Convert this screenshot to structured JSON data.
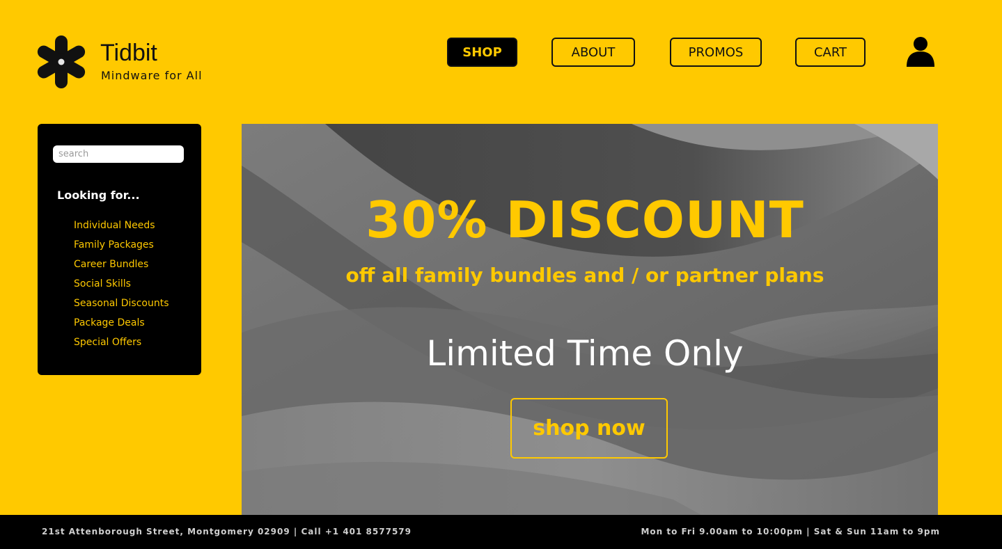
{
  "brand": {
    "name": "Tidbit",
    "tagline": "Mindware for All",
    "logo_icon": "asterisk-flower-icon"
  },
  "nav": {
    "items": [
      {
        "label": "SHOP",
        "active": true
      },
      {
        "label": "ABOUT",
        "active": false
      },
      {
        "label": "PROMOS",
        "active": false
      },
      {
        "label": "CART",
        "active": false
      }
    ],
    "account_icon": "user-icon"
  },
  "sidebar": {
    "search_placeholder": "search",
    "search_value": "",
    "heading": "Looking for...",
    "items": [
      {
        "label": "Individual Needs"
      },
      {
        "label": "Family Packages"
      },
      {
        "label": "Career Bundles"
      },
      {
        "label": "Social Skills"
      },
      {
        "label": "Seasonal Discounts"
      },
      {
        "label": "Package Deals"
      },
      {
        "label": "Special Offers"
      }
    ]
  },
  "hero": {
    "title": "30% DISCOUNT",
    "subtitle": "off all family bundles and / or partner plans",
    "limited": "Limited Time Only",
    "cta_label": "shop now"
  },
  "footer": {
    "address": "21st Attenborough Street, Montgomery 02909 | Call +1 401 8577579",
    "hours": "Mon to Fri 9.00am to 10:00pm | Sat & Sun 11am to 9pm"
  },
  "colors": {
    "brand_yellow": "#FFC900",
    "dark": "#000000",
    "light_text": "#FFFFFF"
  }
}
